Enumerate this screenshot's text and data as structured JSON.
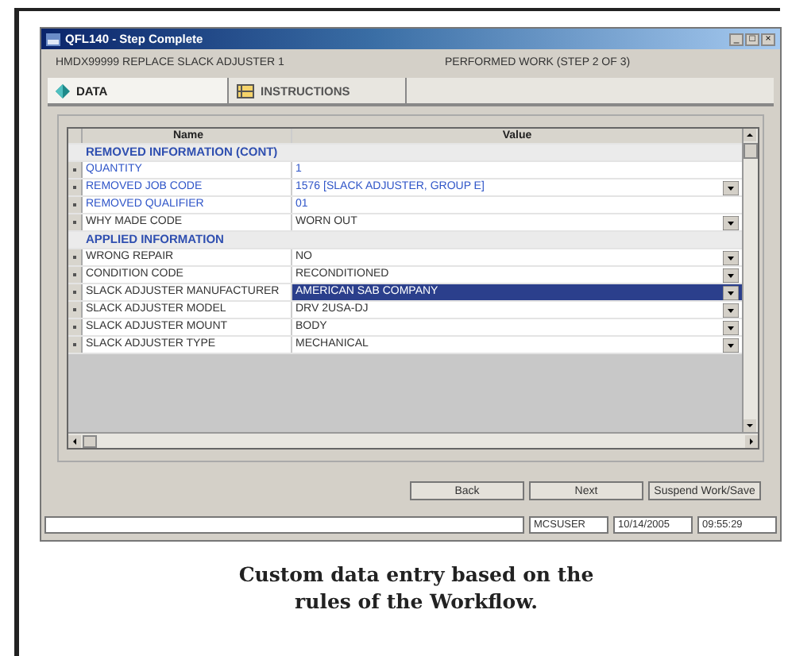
{
  "window": {
    "title": "QFL140 - Step Complete",
    "controls": [
      "_",
      "□",
      "×"
    ]
  },
  "header": {
    "task": "HMDX99999 REPLACE SLACK ADJUSTER 1",
    "step": "PERFORMED WORK (STEP 2 OF 3)"
  },
  "tabs": [
    {
      "label": "DATA",
      "selected": true
    },
    {
      "label": "INSTRUCTIONS",
      "selected": false
    }
  ],
  "table": {
    "columns": [
      "Name",
      "Value"
    ],
    "rows": [
      {
        "kind": "group",
        "name": "REMOVED INFORMATION (CONT)"
      },
      {
        "kind": "field",
        "name": "QUANTITY",
        "value": "1",
        "color": "#2f55c8",
        "dropdown": false,
        "selected": false
      },
      {
        "kind": "field",
        "name": "REMOVED JOB CODE",
        "value": "1576 [SLACK ADJUSTER, GROUP E]",
        "color": "#2f55c8",
        "dropdown": true,
        "selected": false
      },
      {
        "kind": "field",
        "name": "REMOVED QUALIFIER",
        "value": "01",
        "color": "#2f55c8",
        "dropdown": false,
        "selected": false
      },
      {
        "kind": "field",
        "name": "WHY MADE CODE",
        "value": "WORN OUT",
        "color": "#333333",
        "dropdown": true,
        "selected": false
      },
      {
        "kind": "group",
        "name": "APPLIED INFORMATION"
      },
      {
        "kind": "field",
        "name": "WRONG REPAIR",
        "value": "NO",
        "color": "#333333",
        "dropdown": true,
        "selected": false
      },
      {
        "kind": "field",
        "name": "CONDITION CODE",
        "value": "RECONDITIONED",
        "color": "#333333",
        "dropdown": true,
        "selected": false
      },
      {
        "kind": "field",
        "name": "SLACK ADJUSTER MANUFACTURER",
        "value": "AMERICAN SAB COMPANY",
        "color": "#333333",
        "dropdown": true,
        "selected": true
      },
      {
        "kind": "field",
        "name": "SLACK ADJUSTER MODEL",
        "value": "DRV 2USA-DJ",
        "color": "#333333",
        "dropdown": true,
        "selected": false
      },
      {
        "kind": "field",
        "name": "SLACK ADJUSTER MOUNT",
        "value": "BODY",
        "color": "#333333",
        "dropdown": true,
        "selected": false
      },
      {
        "kind": "field",
        "name": "SLACK ADJUSTER TYPE",
        "value": "MECHANICAL",
        "color": "#333333",
        "dropdown": true,
        "selected": false
      }
    ]
  },
  "buttons": [
    "Back",
    "Next",
    "Suspend Work/Save"
  ],
  "status_bar": {
    "user": "MCSUSER",
    "date": "10/14/2005",
    "time": "09:55:29"
  },
  "caption": "Custom data entry based on the rules of the Workflow."
}
